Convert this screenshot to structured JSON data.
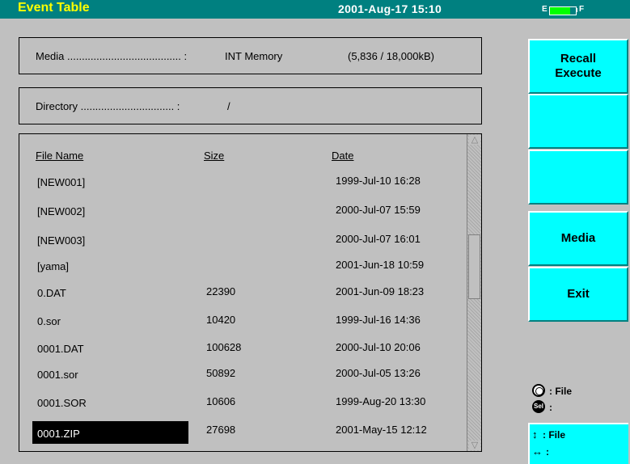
{
  "header": {
    "title": "Event Table",
    "datetime": "2001-Aug-17 15:10",
    "battery": {
      "empty_label": "E",
      "full_label": "F",
      "level": 0.78
    }
  },
  "media": {
    "label": "Media ....................................... :",
    "value": "INT Memory",
    "usage": "(5,836 / 18,000kB)"
  },
  "directory": {
    "label": "Directory ................................ :",
    "value": "/"
  },
  "file_list": {
    "columns": {
      "name": "File Name",
      "size": "Size",
      "date": "Date"
    },
    "rows": [
      {
        "name": "[NEW001]",
        "size": "",
        "date": "1999-Jul-10 16:28"
      },
      {
        "name": "[NEW002]",
        "size": "",
        "date": "2000-Jul-07 15:59"
      },
      {
        "name": "[NEW003]",
        "size": "",
        "date": "2000-Jul-07 16:01"
      },
      {
        "name": "[yama]",
        "size": "",
        "date": "2001-Jun-18 10:59"
      },
      {
        "name": "0.DAT",
        "size": "22390",
        "date": "2001-Jun-09 18:23"
      },
      {
        "name": "0.sor",
        "size": "10420",
        "date": "1999-Jul-16 14:36"
      },
      {
        "name": "0001.DAT",
        "size": "100628",
        "date": "2000-Jul-10 20:06"
      },
      {
        "name": "0001.sor",
        "size": "50892",
        "date": "2000-Jul-05 13:26"
      },
      {
        "name": "0001.SOR",
        "size": "10606",
        "date": "1999-Aug-20 13:30"
      },
      {
        "name": "0001.ZIP",
        "size": "27698",
        "date": "2001-May-15 12:12"
      }
    ],
    "selected_index": 9
  },
  "softkeys": [
    {
      "label": "Recall\nExecute"
    },
    {
      "label": ""
    },
    {
      "label": ""
    },
    {
      "label": "Media"
    },
    {
      "label": "Exit"
    }
  ],
  "legend": {
    "dial": ": File",
    "sel_icon_text": "Sel",
    "sel": ":",
    "updown": ": File",
    "leftright": ":"
  }
}
